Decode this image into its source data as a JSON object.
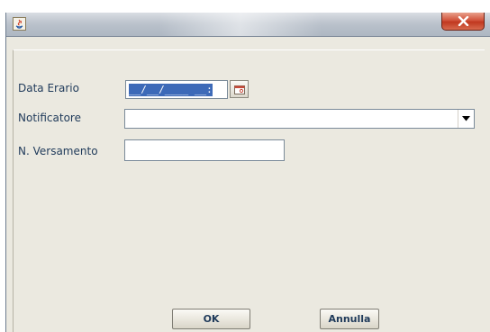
{
  "window": {
    "title": ""
  },
  "form": {
    "date_label": "Data Erario",
    "date_value": "__/__/____ __:__",
    "notifier_label": "Notificatore",
    "notifier_value": "",
    "payment_label": "N. Versamento",
    "payment_value": ""
  },
  "buttons": {
    "ok": "OK",
    "cancel": "Annulla"
  },
  "icons": {
    "app": "java-icon",
    "close": "close-icon",
    "calendar": "calendar-icon",
    "dropdown": "chevron-down-icon"
  },
  "colors": {
    "close_button": "#c9452c",
    "selection": "#3d6ab8",
    "dialog_background": "#ebe9e0",
    "label_text": "#1f3a5a"
  }
}
